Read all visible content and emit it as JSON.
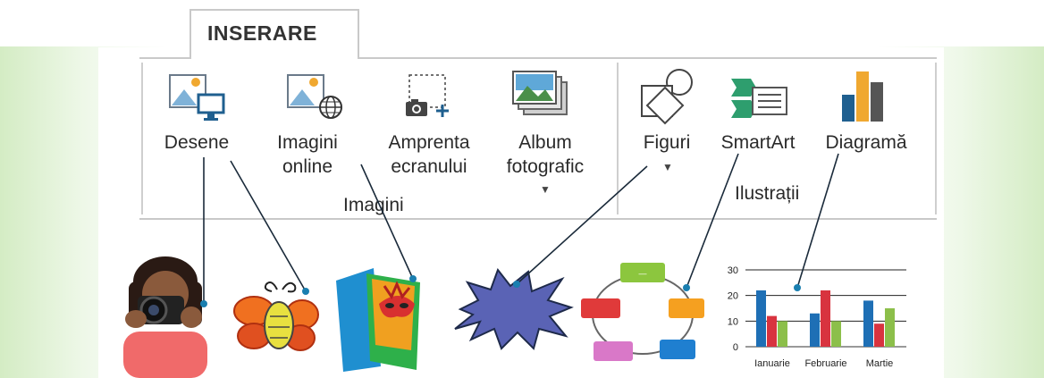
{
  "ribbon": {
    "tab_label": "INSERARE",
    "groups": [
      {
        "label": "Imagini"
      },
      {
        "label": "Ilustrații"
      }
    ],
    "buttons": [
      {
        "icon": "pictures-icon",
        "line1": "Desene",
        "line2": ""
      },
      {
        "icon": "online-pictures-icon",
        "line1": "Imagini",
        "line2": "online"
      },
      {
        "icon": "screenshot-icon",
        "line1": "Amprenta",
        "line2": "ecranului"
      },
      {
        "icon": "photo-album-icon",
        "line1": "Album",
        "line2": "fotografic"
      },
      {
        "icon": "shapes-icon",
        "line1": "Figuri",
        "line2": ""
      },
      {
        "icon": "smartart-icon",
        "line1": "SmartArt",
        "line2": ""
      },
      {
        "icon": "chart-icon",
        "line1": "Diagramă",
        "line2": ""
      }
    ]
  },
  "examples": {
    "smartart_box_text": "—"
  },
  "chart_data": {
    "type": "bar",
    "categories": [
      "Ianuarie",
      "Februarie",
      "Martie"
    ],
    "series": [
      {
        "values": [
          22,
          13,
          18
        ],
        "color": "#1e6fb5"
      },
      {
        "values": [
          12,
          22,
          9
        ],
        "color": "#d8333f"
      },
      {
        "values": [
          10,
          10,
          15
        ],
        "color": "#8cbf4a"
      }
    ],
    "yticks": [
      "30",
      "20",
      "10",
      "0"
    ],
    "ylim": [
      0,
      30
    ],
    "grid": true
  }
}
